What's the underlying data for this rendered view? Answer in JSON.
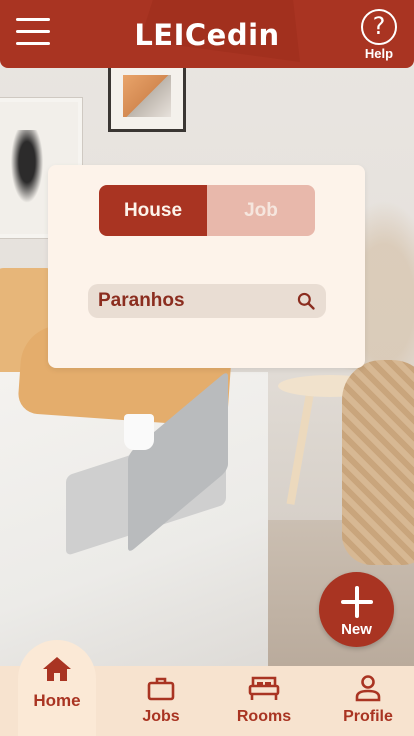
{
  "header": {
    "title": "LEICedin",
    "menu_icon": "hamburger-menu-icon",
    "help_icon": "question-mark-circle-icon",
    "help_label": "Help"
  },
  "search_card": {
    "toggle": {
      "options": [
        "House",
        "Job"
      ],
      "selected": "House"
    },
    "search": {
      "value": "Paranhos",
      "icon": "search-icon"
    }
  },
  "fab": {
    "icon": "plus-icon",
    "label": "New"
  },
  "bottom_nav": {
    "items": [
      {
        "label": "Home",
        "icon": "home-icon",
        "active": true
      },
      {
        "label": "Jobs",
        "icon": "briefcase-icon",
        "active": false
      },
      {
        "label": "Rooms",
        "icon": "bed-icon",
        "active": false
      },
      {
        "label": "Profile",
        "icon": "person-icon",
        "active": false
      }
    ]
  },
  "colors": {
    "primary": "#a93422",
    "card_bg": "#fdf3ea",
    "toggle_inactive": "#e8b8ab",
    "nav_bg": "#f7e3cf"
  }
}
